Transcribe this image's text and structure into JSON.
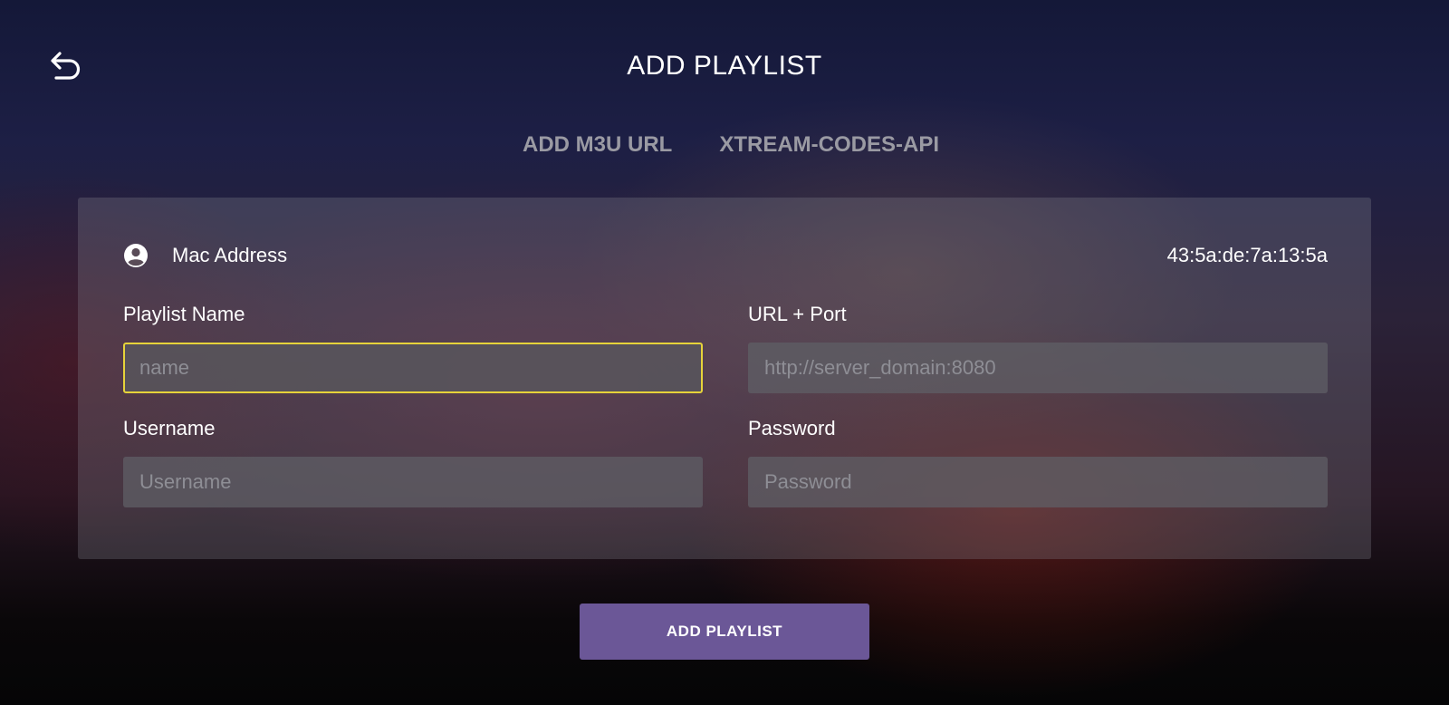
{
  "header": {
    "title": "ADD PLAYLIST",
    "back_icon": "undo-arrow-icon"
  },
  "tabs": [
    {
      "label": "ADD M3U URL"
    },
    {
      "label": "XTREAM-CODES-API"
    }
  ],
  "panel": {
    "mac": {
      "icon": "account-circle-icon",
      "label": "Mac Address",
      "value": "43:5a:de:7a:13:5a"
    },
    "fields": {
      "playlist_name": {
        "label": "Playlist Name",
        "placeholder": "name",
        "value": ""
      },
      "url_port": {
        "label": "URL + Port",
        "placeholder": "http://server_domain:8080",
        "value": ""
      },
      "username": {
        "label": "Username",
        "placeholder": "Username",
        "value": ""
      },
      "password": {
        "label": "Password",
        "placeholder": "Password",
        "value": ""
      }
    }
  },
  "submit": {
    "label": "ADD PLAYLIST"
  },
  "colors": {
    "accent_button": "#6b5797",
    "focus_border": "#e6d33a",
    "tab_text": "#9a9aa3"
  }
}
